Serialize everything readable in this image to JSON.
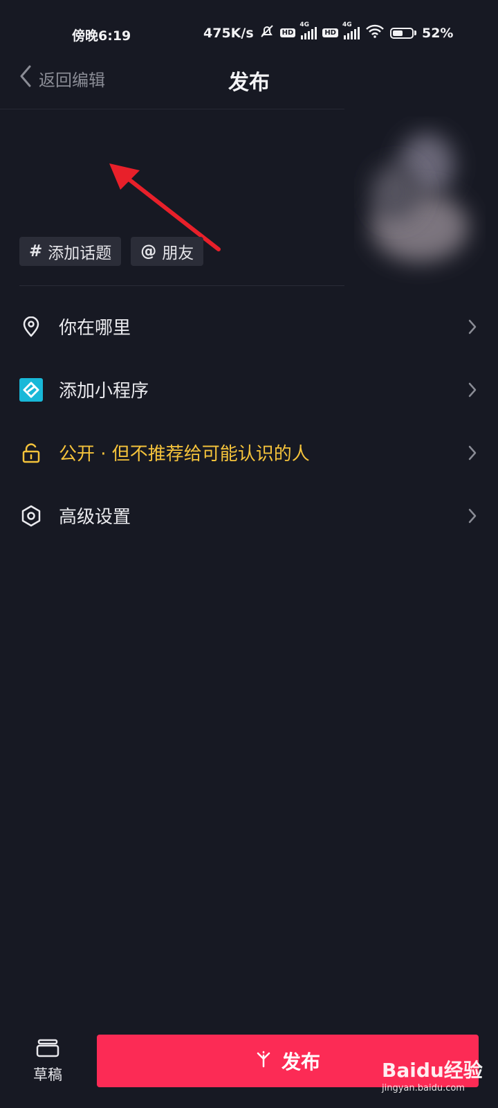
{
  "status_bar": {
    "time": "傍晚6:19",
    "network_speed": "475K/s",
    "sim1_badge": "HD",
    "sim1_type": "4G",
    "sim2_badge": "HD",
    "sim2_type": "4G",
    "battery": "52%"
  },
  "nav": {
    "back_label": "返回编辑",
    "title": "发布"
  },
  "chips": [
    {
      "symbol": "#",
      "label": "添加话题"
    },
    {
      "symbol": "@",
      "label": "朋友"
    }
  ],
  "menu": {
    "location": "你在哪里",
    "mini_program": "添加小程序",
    "privacy": "公开 · 但不推荐给可能认识的人",
    "advanced": "高级设置"
  },
  "bottom": {
    "drafts_label": "草稿",
    "publish_label": "发布"
  },
  "watermark": {
    "brand": "Baidu经验",
    "url": "jingyan.baidu.com"
  },
  "colors": {
    "background": "#171923",
    "publish_button": "#fc2b55",
    "privacy_text": "#f5c33b",
    "mini_program_icon": "#18b8d8",
    "annotation_arrow": "#e8202a"
  }
}
